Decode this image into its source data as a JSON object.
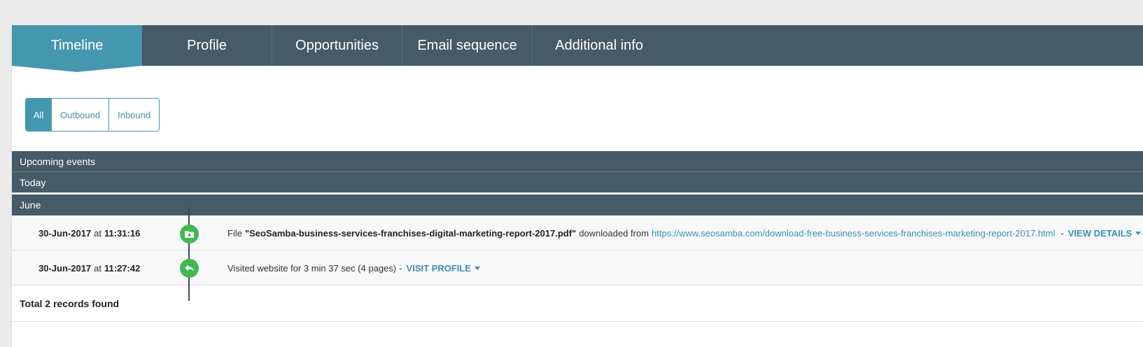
{
  "tabs": [
    {
      "label": "Timeline",
      "active": true
    },
    {
      "label": "Profile",
      "active": false
    },
    {
      "label": "Opportunities",
      "active": false
    },
    {
      "label": "Email sequence",
      "active": false
    },
    {
      "label": "Additional info",
      "active": false
    }
  ],
  "filter": {
    "all": "All",
    "outbound": "Outbound",
    "inbound": "Inbound",
    "selected": "All"
  },
  "sections": {
    "upcoming": "Upcoming events",
    "today": "Today",
    "june": "June"
  },
  "events": [
    {
      "date": "30-Jun-2017",
      "at": "at",
      "time": "11:31:16",
      "icon": "folder-download-icon",
      "prefix": "File",
      "filename": "\"SeoSamba-business-services-franchises-digital-marketing-report-2017.pdf\"",
      "middle": "downloaded from",
      "url": "https://www.seosamba.com/download-free-business-services-franchises-marketing-report-2017.html",
      "sep": "-",
      "action": "VIEW DETAILS"
    },
    {
      "date": "30-Jun-2017",
      "at": "at",
      "time": "11:27:42",
      "icon": "reply-arrow-icon",
      "text": "Visited website for 3 min 37 sec (4 pages)",
      "sep": "-",
      "action": "VISIT PROFILE"
    }
  ],
  "footer": {
    "total": "Total 2 records found"
  },
  "colors": {
    "header": "#465a67",
    "accent": "#4597af",
    "event_dot": "#3fb950",
    "link": "#3d8fb3"
  }
}
